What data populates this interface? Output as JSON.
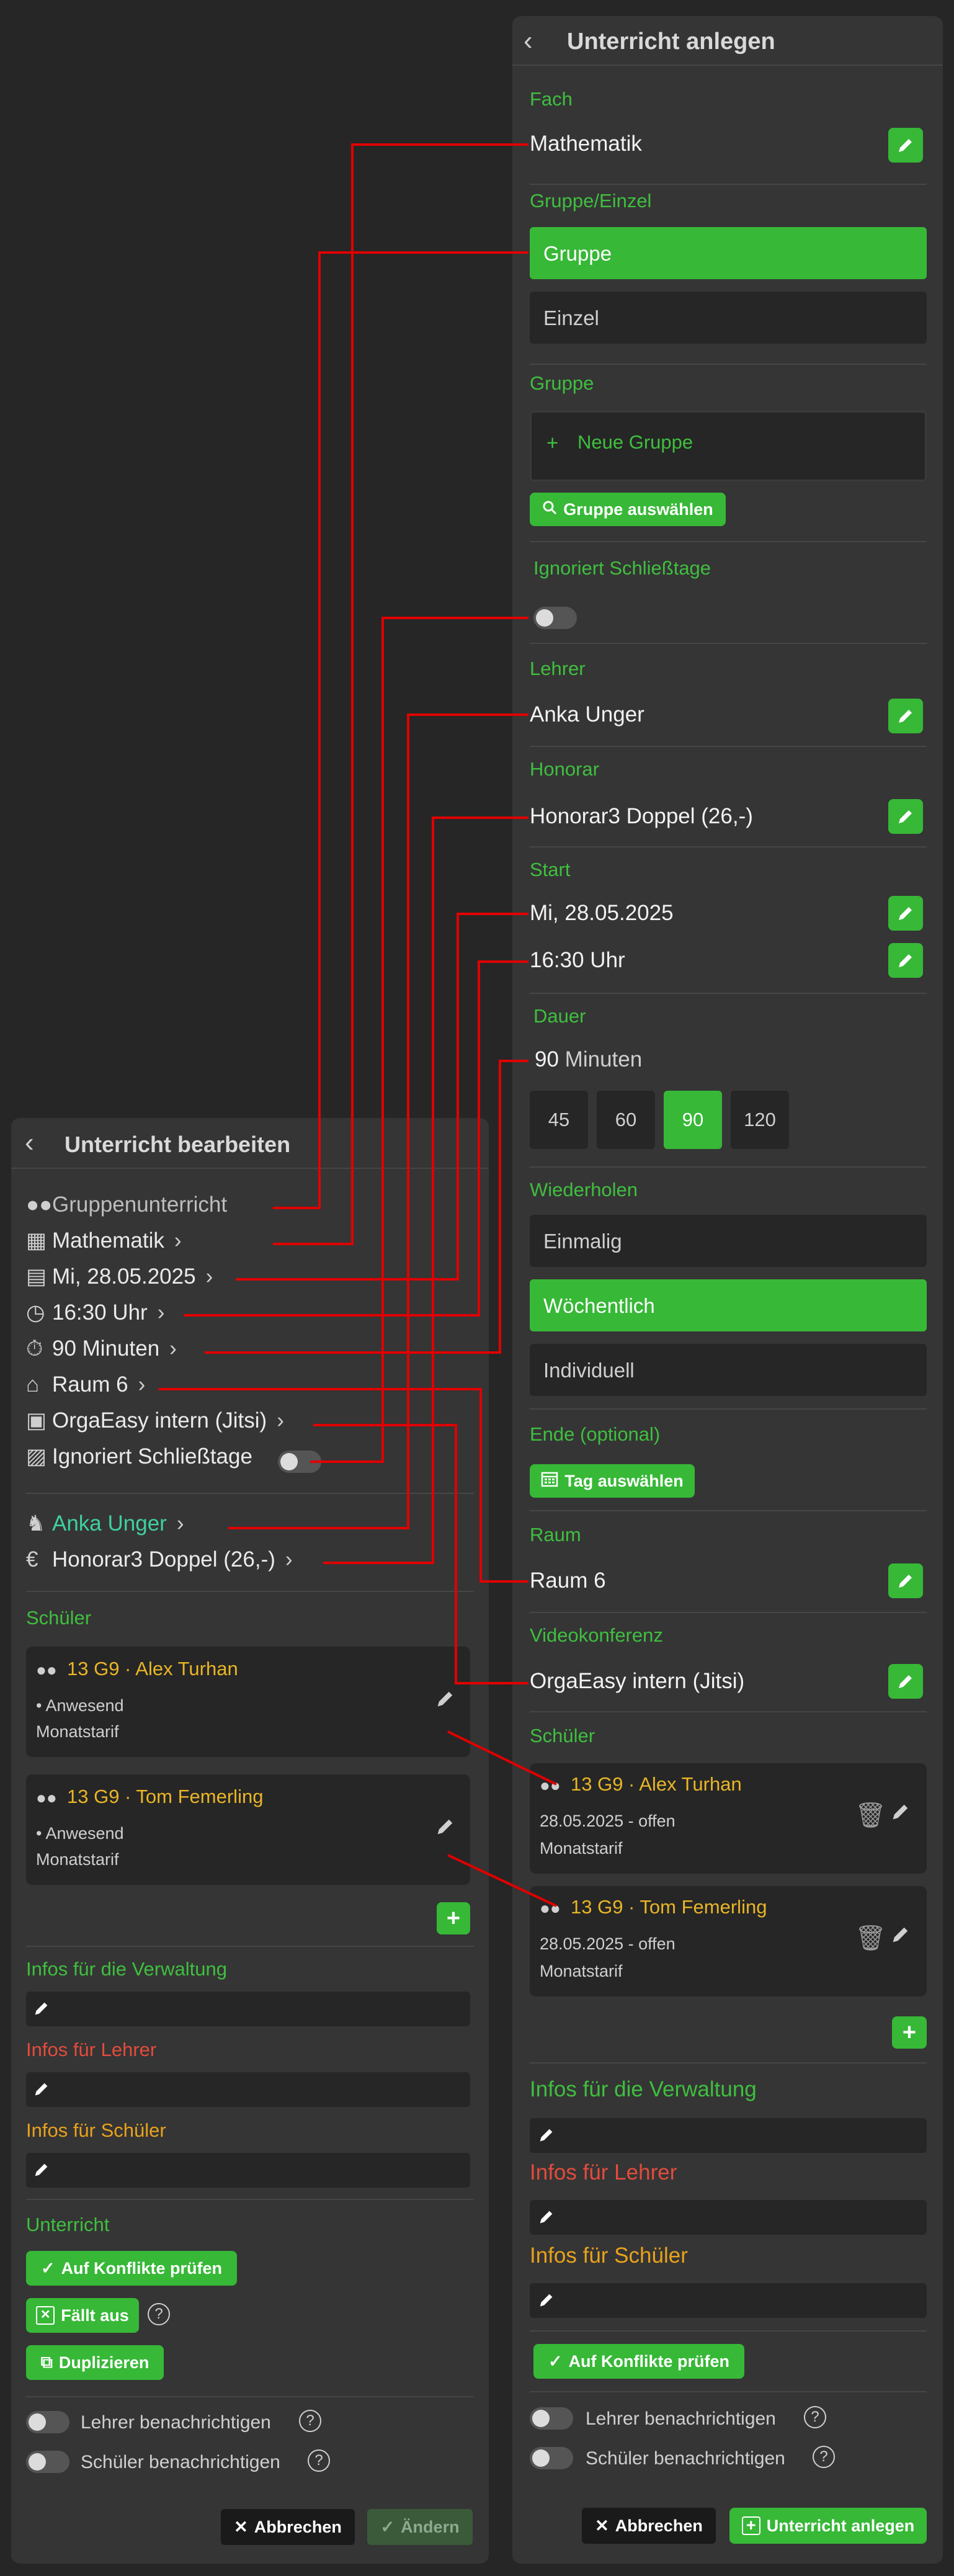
{
  "right": {
    "title": "Unterricht anlegen",
    "fach": {
      "label": "Fach",
      "value": "Mathematik"
    },
    "gruppe_einzel": {
      "label": "Gruppe/Einzel",
      "gruppe": "Gruppe",
      "einzel": "Einzel"
    },
    "gruppe": {
      "label": "Gruppe",
      "new_group": "Neue Gruppe",
      "select": "Gruppe auswählen"
    },
    "schliesstage": {
      "label": "Ignoriert Schließtage"
    },
    "lehrer": {
      "label": "Lehrer",
      "value": "Anka Unger"
    },
    "honorar": {
      "label": "Honorar",
      "value": "Honorar3 Doppel (26,-)"
    },
    "start": {
      "label": "Start",
      "date": "Mi, 28.05.2025",
      "time": "16:30 Uhr"
    },
    "dauer": {
      "label": "Dauer",
      "value": "90",
      "unit": "Minuten",
      "options": [
        "45",
        "60",
        "90",
        "120"
      ],
      "selected": "90"
    },
    "wiederholen": {
      "label": "Wiederholen",
      "opt1": "Einmalig",
      "opt2": "Wöchentlich",
      "opt3": "Individuell"
    },
    "ende": {
      "label": "Ende (optional)",
      "button": "Tag auswählen"
    },
    "raum": {
      "label": "Raum",
      "value": "Raum 6"
    },
    "video": {
      "label": "Videokonferenz",
      "value": "OrgaEasy intern (Jitsi)"
    },
    "schueler": {
      "label": "Schüler",
      "items": [
        {
          "name": "13 G9 · Alex Turhan",
          "line2": "28.05.2025 - offen",
          "line3": "Monatstarif"
        },
        {
          "name": "13 G9 · Tom Femerling",
          "line2": "28.05.2025 - offen",
          "line3": "Monatstarif"
        }
      ]
    },
    "infos_verwaltung": "Infos für die Verwaltung",
    "infos_lehrer": "Infos für Lehrer",
    "infos_schueler": "Infos für Schüler",
    "konflikte": "Auf Konflikte prüfen",
    "notify_lehrer": "Lehrer benachrichtigen",
    "notify_schueler": "Schüler benachrichtigen",
    "cancel": "Abbrechen",
    "create": "Unterricht anlegen"
  },
  "left": {
    "title": "Unterricht bearbeiten",
    "summary": {
      "type": "Gruppenunterricht",
      "subject": "Mathematik",
      "date": "Mi, 28.05.2025",
      "time": "16:30 Uhr",
      "duration": "90 Minuten",
      "room": "Raum 6",
      "video": "OrgaEasy intern (Jitsi)",
      "closing": "Ignoriert Schließtage",
      "teacher": "Anka Unger",
      "fee": "Honorar3 Doppel (26,-)"
    },
    "schueler": {
      "label": "Schüler",
      "items": [
        {
          "name": "13 G9 · Alex Turhan",
          "line2": "Anwesend",
          "line3": "Monatstarif"
        },
        {
          "name": "13 G9 · Tom Femerling",
          "line2": "Anwesend",
          "line3": "Monatstarif"
        }
      ]
    },
    "infos_verwaltung": "Infos für die Verwaltung",
    "infos_lehrer": "Infos für Lehrer",
    "infos_schueler": "Infos für Schüler",
    "unterricht_label": "Unterricht",
    "konflikte": "Auf Konflikte prüfen",
    "faellt_aus": "Fällt aus",
    "duplizieren": "Duplizieren",
    "notify_lehrer": "Lehrer benachrichtigen",
    "notify_schueler": "Schüler benachrichtigen",
    "cancel": "Abbrechen",
    "change": "Ändern"
  },
  "colors": {
    "accent": "#37b837",
    "label_green": "#3fbf3f",
    "label_red": "#e24c3c",
    "label_orange": "#e9a21c",
    "student_name": "#e9b526",
    "connector": "#e00000",
    "teacher_link": "#3fd0a0"
  },
  "icons": [
    "chevron-left-icon",
    "pencil-icon",
    "plus-icon",
    "search-icon",
    "calendar-icon",
    "trash-icon",
    "check-icon",
    "close-icon",
    "group-icon",
    "clock-icon",
    "timer-icon",
    "building-icon",
    "video-icon",
    "teacher-icon",
    "euro-icon",
    "help-icon",
    "copy-icon"
  ]
}
